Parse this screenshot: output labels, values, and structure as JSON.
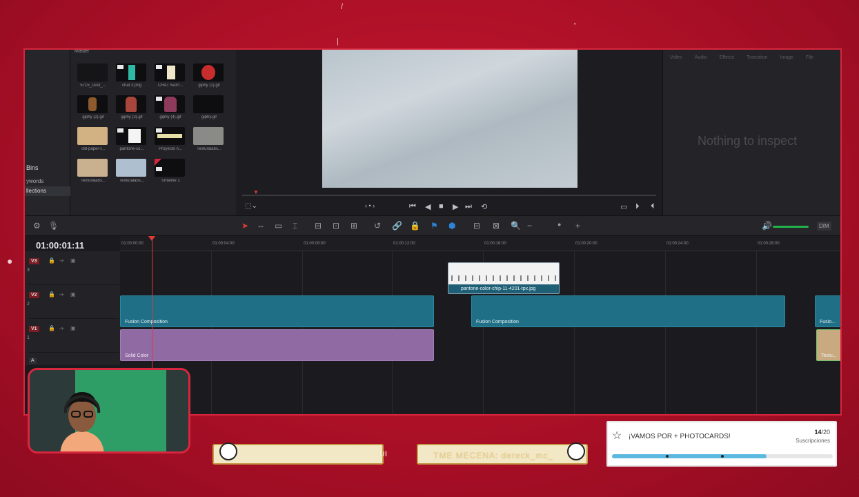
{
  "media_pool": {
    "header": "Master",
    "sidebar": [
      "Bins",
      "ywords",
      "llections"
    ],
    "clips": [
      {
        "name": "5715_Dust_..."
      },
      {
        "name": "chat 3.png"
      },
      {
        "name": "CHAT NAVI..."
      },
      {
        "name": "giphy (1).gif"
      },
      {
        "name": "giphy (2).gif"
      },
      {
        "name": "giphy (3).gif"
      },
      {
        "name": "giphy (4).gif"
      },
      {
        "name": "giphy.gif"
      },
      {
        "name": "old-paper-t..."
      },
      {
        "name": "pantone-co..."
      },
      {
        "name": "Proyecto n..."
      },
      {
        "name": "Texturalabs..."
      },
      {
        "name": "Texturalabs..."
      },
      {
        "name": "Texturalabs..."
      },
      {
        "name": "Timeline 1"
      }
    ]
  },
  "inspector": {
    "tabs": [
      "Video",
      "Audio",
      "Effects",
      "Transition",
      "Image",
      "File"
    ],
    "empty_message": "Nothing to inspect"
  },
  "toolbar": {
    "dim_label": "DIM"
  },
  "timeline": {
    "timecode": "01:00:01:11",
    "ruler": [
      "01:00:00:00",
      "01:00:04:00",
      "01:00:08:00",
      "01:00:12:00",
      "01:00:16:00",
      "01:00:20:00",
      "01:00:24:00",
      "01:00:28:00"
    ],
    "tracks": [
      {
        "id": "V3",
        "num": "3"
      },
      {
        "id": "V2",
        "num": "2"
      },
      {
        "id": "V1",
        "num": "1"
      }
    ],
    "clips": {
      "still": "pantone-color-chip-11-4201-tpx.jpg",
      "fusion1": "Fusion Composition",
      "fusion2": "Fusion Composition",
      "fusion3": "Fusio...",
      "solid": "Solid Color",
      "texture": "Textu..."
    },
    "audio_track": "A"
  },
  "overlay": {
    "ribbon1_text": "Ul",
    "ribbon2_text": "TME MECENA: dereck_mc_",
    "goal": {
      "title": "¡VAMOS POR + PHOTOCARDS!",
      "current": "14",
      "total": "/20",
      "subtitle": "Suscripciones",
      "progress": 0.7
    }
  },
  "colors": {
    "background": "#b3122c",
    "frame_border": "#d8263d",
    "fusion_clip": "#1f6f86",
    "solid_clip": "#8f6aa3",
    "playhead": "#e03b3b",
    "goal_bar": "#5bb9e0"
  }
}
